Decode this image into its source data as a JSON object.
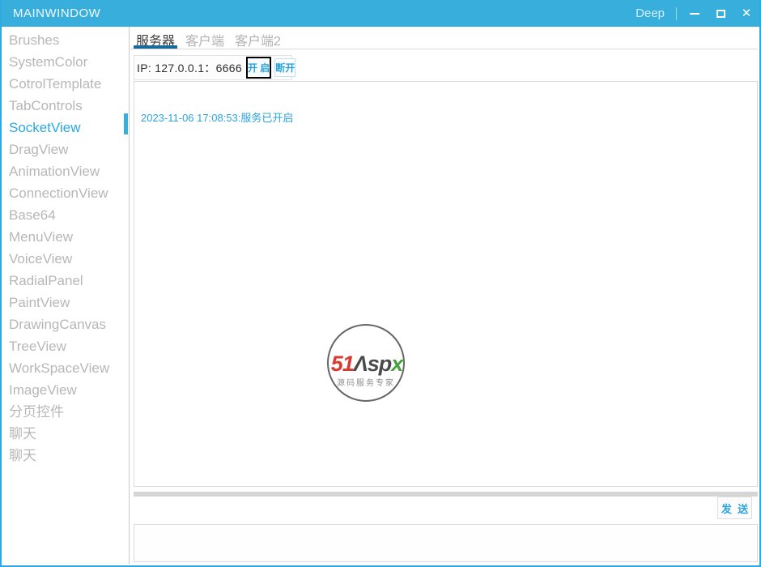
{
  "window": {
    "title": "MAINWINDOW",
    "border_color": "#2eaade",
    "titlebar_color": "#38aedd"
  },
  "titlebar": {
    "deep_label": "Deep",
    "minimize_icon": "minimize",
    "maximize_icon": "maximize",
    "close_icon": "✕"
  },
  "sidebar": {
    "active_index": 4,
    "active_color": "#2ba8e0",
    "inactive_color": "#b7b7b7",
    "items": [
      {
        "label": "Brushes"
      },
      {
        "label": "SystemColor"
      },
      {
        "label": "CotrolTemplate"
      },
      {
        "label": "TabControls"
      },
      {
        "label": "SocketView"
      },
      {
        "label": "DragView"
      },
      {
        "label": "AnimationView"
      },
      {
        "label": "ConnectionView"
      },
      {
        "label": "Base64"
      },
      {
        "label": "MenuView"
      },
      {
        "label": "VoiceView"
      },
      {
        "label": "RadialPanel"
      },
      {
        "label": "PaintView"
      },
      {
        "label": "DrawingCanvas"
      },
      {
        "label": "TreeView"
      },
      {
        "label": "WorkSpaceView"
      },
      {
        "label": "ImageView"
      },
      {
        "label": "分页控件"
      },
      {
        "label": "聊天"
      },
      {
        "label": "聊天"
      }
    ]
  },
  "tabs": {
    "active_index": 0,
    "underline_color": "#176a99",
    "items": [
      {
        "label": "服务器"
      },
      {
        "label": "客户端"
      },
      {
        "label": "客户端2"
      }
    ]
  },
  "server_panel": {
    "ip_line": "IP:  127.0.0.1：6666",
    "open_button": "开 启",
    "disconnect_button": "断开",
    "log_message": "2023-11-06 17:08:53:服务已开启",
    "log_color": "#2ba3df",
    "send_button": "发  送"
  },
  "watermark": {
    "text_51": "51",
    "text_asp": "Λsp",
    "text_x": "x",
    "subtitle": "源码服务专家",
    "color_51": "#d93a32",
    "color_asp": "#4a4a4a",
    "color_x": "#46a33c"
  }
}
